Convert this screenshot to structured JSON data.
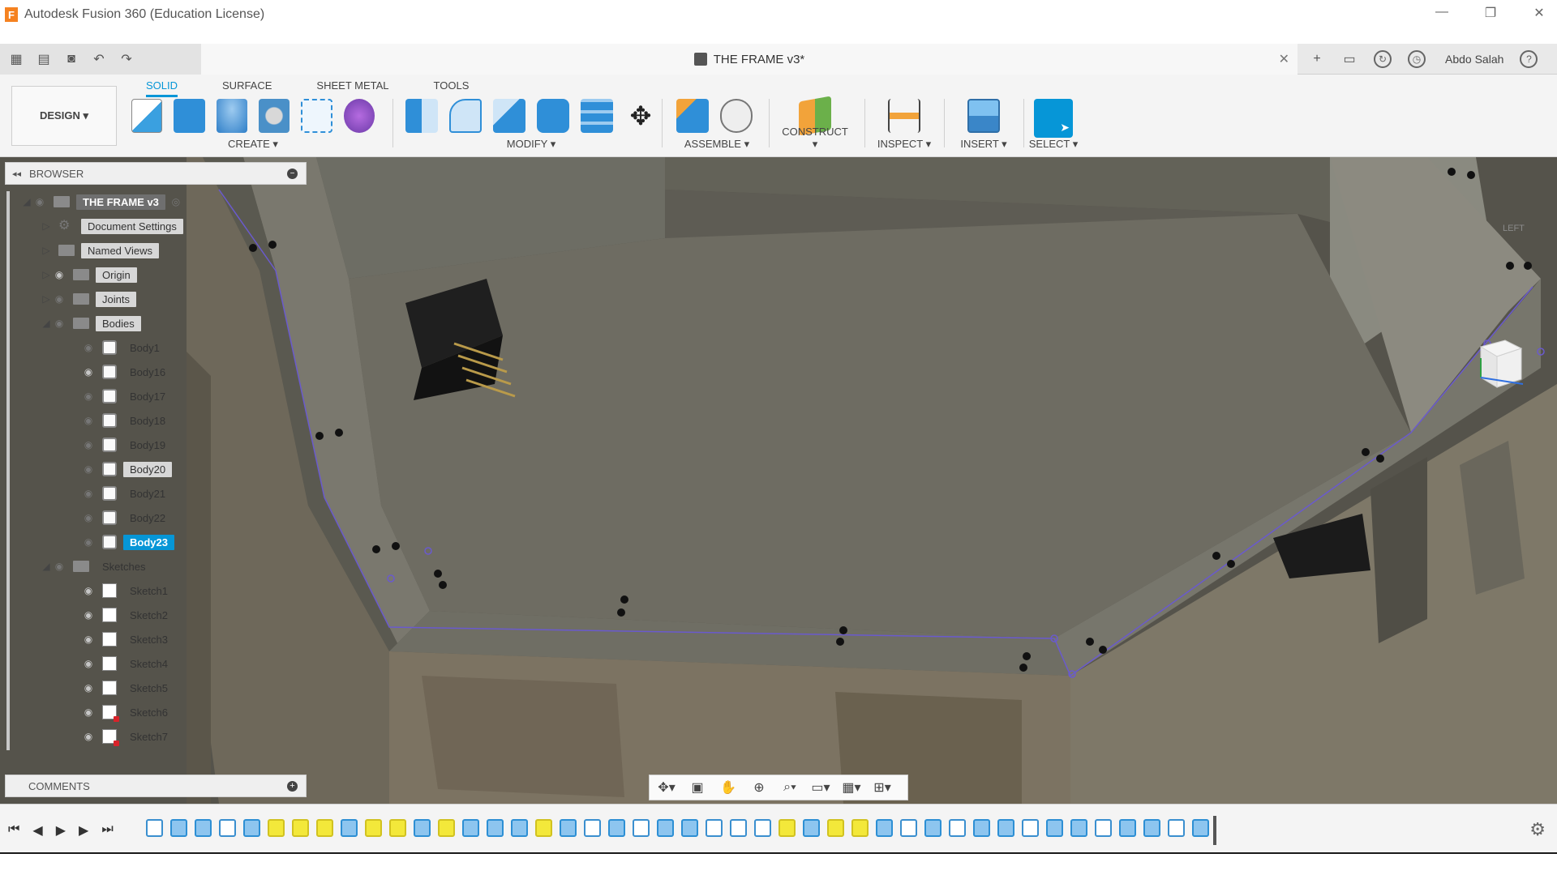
{
  "window": {
    "title": "Autodesk Fusion 360 (Education License)",
    "logo": "F",
    "controls": {
      "minimize": "—",
      "restore": "❐",
      "close": "✕"
    }
  },
  "topbar": {
    "document_title": "THE FRAME v3*",
    "close_tab": "✕",
    "user_name": "Abdo Salah",
    "icons": [
      "grid-icon",
      "file-icon",
      "save-icon",
      "undo-icon",
      "redo-icon",
      "plus-icon",
      "comment-icon",
      "help-circle-icon",
      "clock-icon",
      "question-icon"
    ]
  },
  "ribbon": {
    "workspace": "DESIGN ▾",
    "tabs": [
      {
        "label": "SOLID",
        "active": true
      },
      {
        "label": "SURFACE",
        "active": false
      },
      {
        "label": "SHEET METAL",
        "active": false
      },
      {
        "label": "TOOLS",
        "active": false
      }
    ],
    "groups": {
      "create": "CREATE ▾",
      "modify": "MODIFY ▾",
      "assemble": "ASSEMBLE ▾",
      "construct": "CONSTRUCT ▾",
      "inspect": "INSPECT ▾",
      "insert": "INSERT ▾",
      "select": "SELECT ▾"
    },
    "colors": {
      "accent": "#0696d7",
      "select_button": "#0696d7"
    }
  },
  "browser": {
    "header": "BROWSER",
    "root": "THE FRAME v3",
    "folders": {
      "document_settings": "Document Settings",
      "named_views": "Named Views",
      "origin": "Origin",
      "joints": "Joints",
      "bodies": "Bodies",
      "sketches": "Sketches"
    },
    "bodies": [
      {
        "label": "Body1",
        "visible": true,
        "selected": false
      },
      {
        "label": "Body16",
        "visible": false,
        "selected": false
      },
      {
        "label": "Body17",
        "visible": true,
        "selected": false
      },
      {
        "label": "Body18",
        "visible": true,
        "selected": false
      },
      {
        "label": "Body19",
        "visible": true,
        "selected": false
      },
      {
        "label": "Body20",
        "visible": true,
        "selected": false
      },
      {
        "label": "Body21",
        "visible": true,
        "selected": false
      },
      {
        "label": "Body22",
        "visible": true,
        "selected": false
      },
      {
        "label": "Body23",
        "visible": true,
        "selected": true
      }
    ],
    "sketches": [
      {
        "label": "Sketch1",
        "warning": false
      },
      {
        "label": "Sketch2",
        "warning": false
      },
      {
        "label": "Sketch3",
        "warning": false
      },
      {
        "label": "Sketch4",
        "warning": false
      },
      {
        "label": "Sketch5",
        "warning": false
      },
      {
        "label": "Sketch6",
        "warning": true
      },
      {
        "label": "Sketch7",
        "warning": true
      }
    ]
  },
  "comments": {
    "header": "COMMENTS"
  },
  "viewcube": {
    "face_label": "LEFT"
  },
  "timeline": {
    "playback": [
      "⏮",
      "◀",
      "▶",
      "▶",
      "⏭"
    ],
    "item_count": 44
  }
}
